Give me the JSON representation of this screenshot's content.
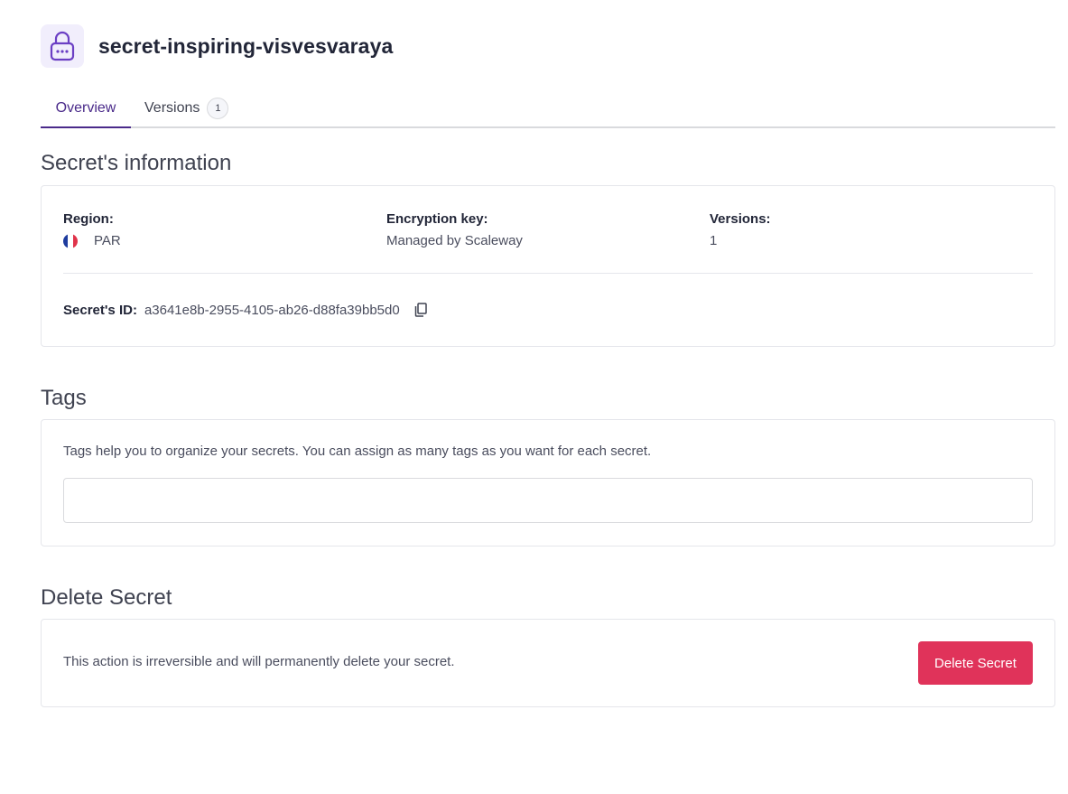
{
  "header": {
    "title": "secret-inspiring-visvesvaraya",
    "icon": "lock-icon"
  },
  "tabs": [
    {
      "label": "Overview",
      "active": true
    },
    {
      "label": "Versions",
      "count": "1",
      "active": false
    }
  ],
  "info": {
    "section_title": "Secret's information",
    "region_label": "Region:",
    "region_value": "PAR",
    "encryption_label": "Encryption key:",
    "encryption_value": "Managed by Scaleway",
    "versions_label": "Versions:",
    "versions_value": "1",
    "id_label": "Secret's ID:",
    "id_value": "a3641e8b-2955-4105-ab26-d88fa39bb5d0"
  },
  "tags": {
    "section_title": "Tags",
    "help": "Tags help you to organize your secrets. You can assign as many tags as you want for each secret.",
    "input_value": ""
  },
  "delete": {
    "section_title": "Delete Secret",
    "description": "This action is irreversible and will permanently delete your secret.",
    "button_label": "Delete Secret"
  },
  "colors": {
    "accent": "#4a2a8a",
    "danger": "#e0335a",
    "icon_bg": "#f1eefc"
  }
}
